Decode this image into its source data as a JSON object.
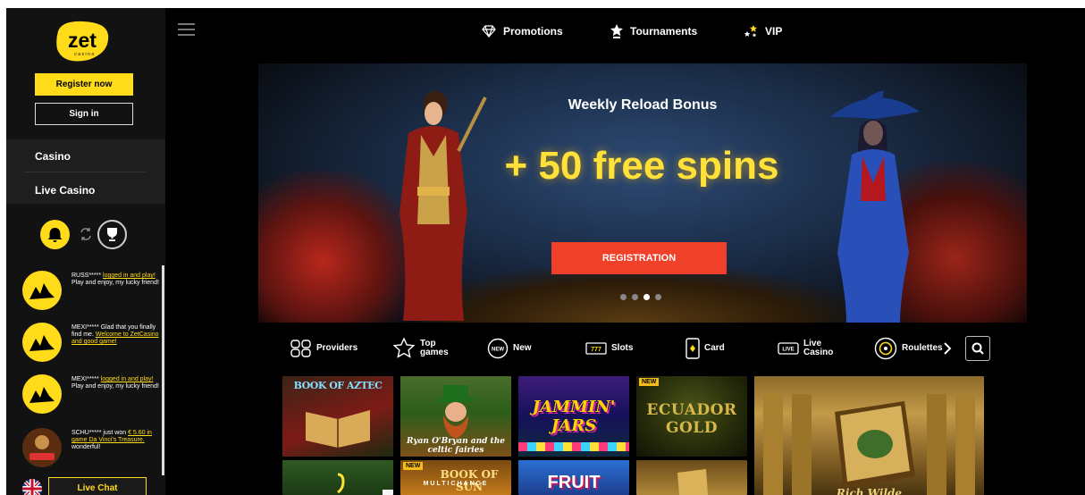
{
  "brand": {
    "logo_text": "zet",
    "logo_subtext": "casino"
  },
  "sidebar": {
    "register_label": "Register now",
    "signin_label": "Sign in",
    "nav": [
      {
        "label": "Casino"
      },
      {
        "label": "Live Casino"
      }
    ],
    "toggles": [
      "bell-icon",
      "swap-icon",
      "trophy-icon"
    ],
    "feed": [
      {
        "user": "RUSS*****",
        "link": "logged in and play!",
        "rest": "Play and enjoy, my lucky friend!"
      },
      {
        "user": "MEXI*****",
        "pre": "Glad that you finally find me.",
        "link": "Welcome to ZetCasino and good game!"
      },
      {
        "user": "MEXI*****",
        "link": "logged in and play!",
        "rest": "Play and enjoy, my lucky friend!"
      },
      {
        "user": "SCHU*****",
        "pre": "just won",
        "link": "€ 5.60 in game Da Vinci's Treasure.",
        "rest": "wonderful!"
      }
    ],
    "live_chat_label": "Live Chat"
  },
  "topnav": {
    "items": [
      {
        "label": "Promotions",
        "icon": "diamond-icon"
      },
      {
        "label": "Tournaments",
        "icon": "star-trophy-icon"
      },
      {
        "label": "VIP",
        "icon": "stars-icon"
      }
    ]
  },
  "banner": {
    "subtitle": "Weekly Reload Bonus",
    "title": "+ 50 free spins",
    "cta": "REGISTRATION",
    "slides": 4,
    "active_slide": 2
  },
  "categories": [
    {
      "label": "Providers",
      "icon": "providers-icon"
    },
    {
      "label": "Top\ngames",
      "icon": "star-icon"
    },
    {
      "label": "New",
      "icon": "new-icon"
    },
    {
      "label": "Slots",
      "icon": "slots-icon"
    },
    {
      "label": "Card",
      "icon": "card-icon"
    },
    {
      "label": "Live\nCasino",
      "icon": "live-icon"
    },
    {
      "label": "Roulettes",
      "icon": "roulette-icon"
    }
  ],
  "games": [
    {
      "title": "BOOK OF AZTEC",
      "badge": ""
    },
    {
      "title": "Ryan O'Bryan and the celtic fairies",
      "badge": ""
    },
    {
      "title": "JAMMIN' JARS",
      "badge": ""
    },
    {
      "title": "ECUADOR GOLD",
      "badge": "NEW"
    },
    {
      "title": "Rich Wilde",
      "badge": ""
    },
    {
      "title": "",
      "badge": ""
    },
    {
      "title": "BOOK OF SUN",
      "subtitle": "MULTICHANCE",
      "badge": "NEW"
    },
    {
      "title": "FRUIT",
      "badge": ""
    },
    {
      "title": "",
      "badge": ""
    }
  ]
}
